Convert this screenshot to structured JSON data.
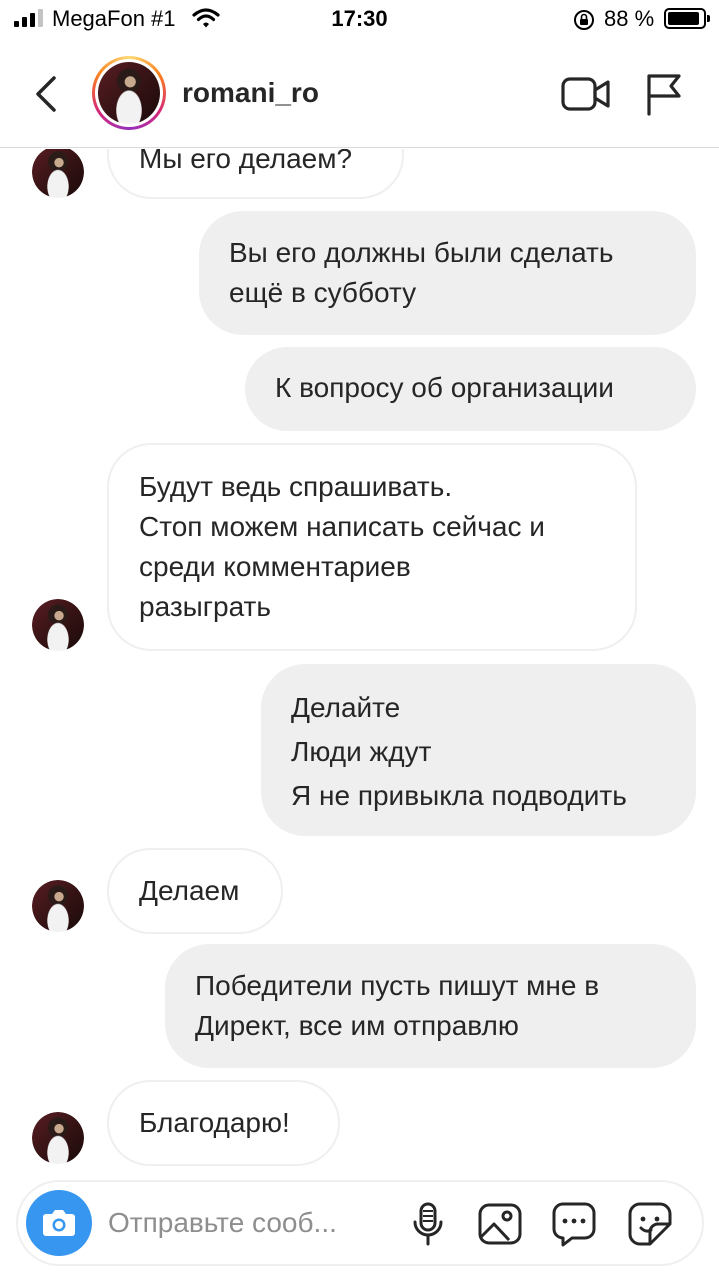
{
  "status_bar": {
    "carrier": "MegaFon #1",
    "time": "17:30",
    "battery_percent": "88 %",
    "signal_bars": 4,
    "signal_bars_active": 3
  },
  "header": {
    "username": "romani_ro"
  },
  "messages": [
    {
      "side": "in",
      "lines": [
        "Мы его делаем?"
      ]
    },
    {
      "side": "out",
      "lines": [
        "Вы его должны были сделать",
        "ещё в субботу"
      ]
    },
    {
      "side": "out",
      "lines": [
        "К вопросу об организации"
      ]
    },
    {
      "side": "in",
      "lines": [
        "Будут ведь спрашивать.",
        "Стоп можем написать сейчас и",
        "среди комментариев",
        "разыграть"
      ]
    },
    {
      "side": "out",
      "lines": [
        "Делайте",
        "Люди ждут",
        "Я не привыкла подводить"
      ]
    },
    {
      "side": "in",
      "lines": [
        "Делаем"
      ]
    },
    {
      "side": "out",
      "lines": [
        "Победители  пусть пишут мне в",
        "Директ, все им отправлю"
      ]
    },
    {
      "side": "in",
      "lines": [
        "Благодарю!"
      ]
    }
  ],
  "composer": {
    "placeholder": "Отправьте сооб..."
  },
  "colors": {
    "outgoing_bubble": "#efefef",
    "incoming_border": "#efefef",
    "camera_button": "#3797f0",
    "text": "#262626",
    "placeholder": "#8e8e8e"
  },
  "icons": {
    "back": "chevron-left-icon",
    "video": "video-camera-icon",
    "flag": "flag-icon",
    "camera": "camera-icon",
    "microphone": "microphone-icon",
    "gallery": "image-gallery-icon",
    "chat": "chat-bubble-icon",
    "sticker": "sticker-icon"
  }
}
